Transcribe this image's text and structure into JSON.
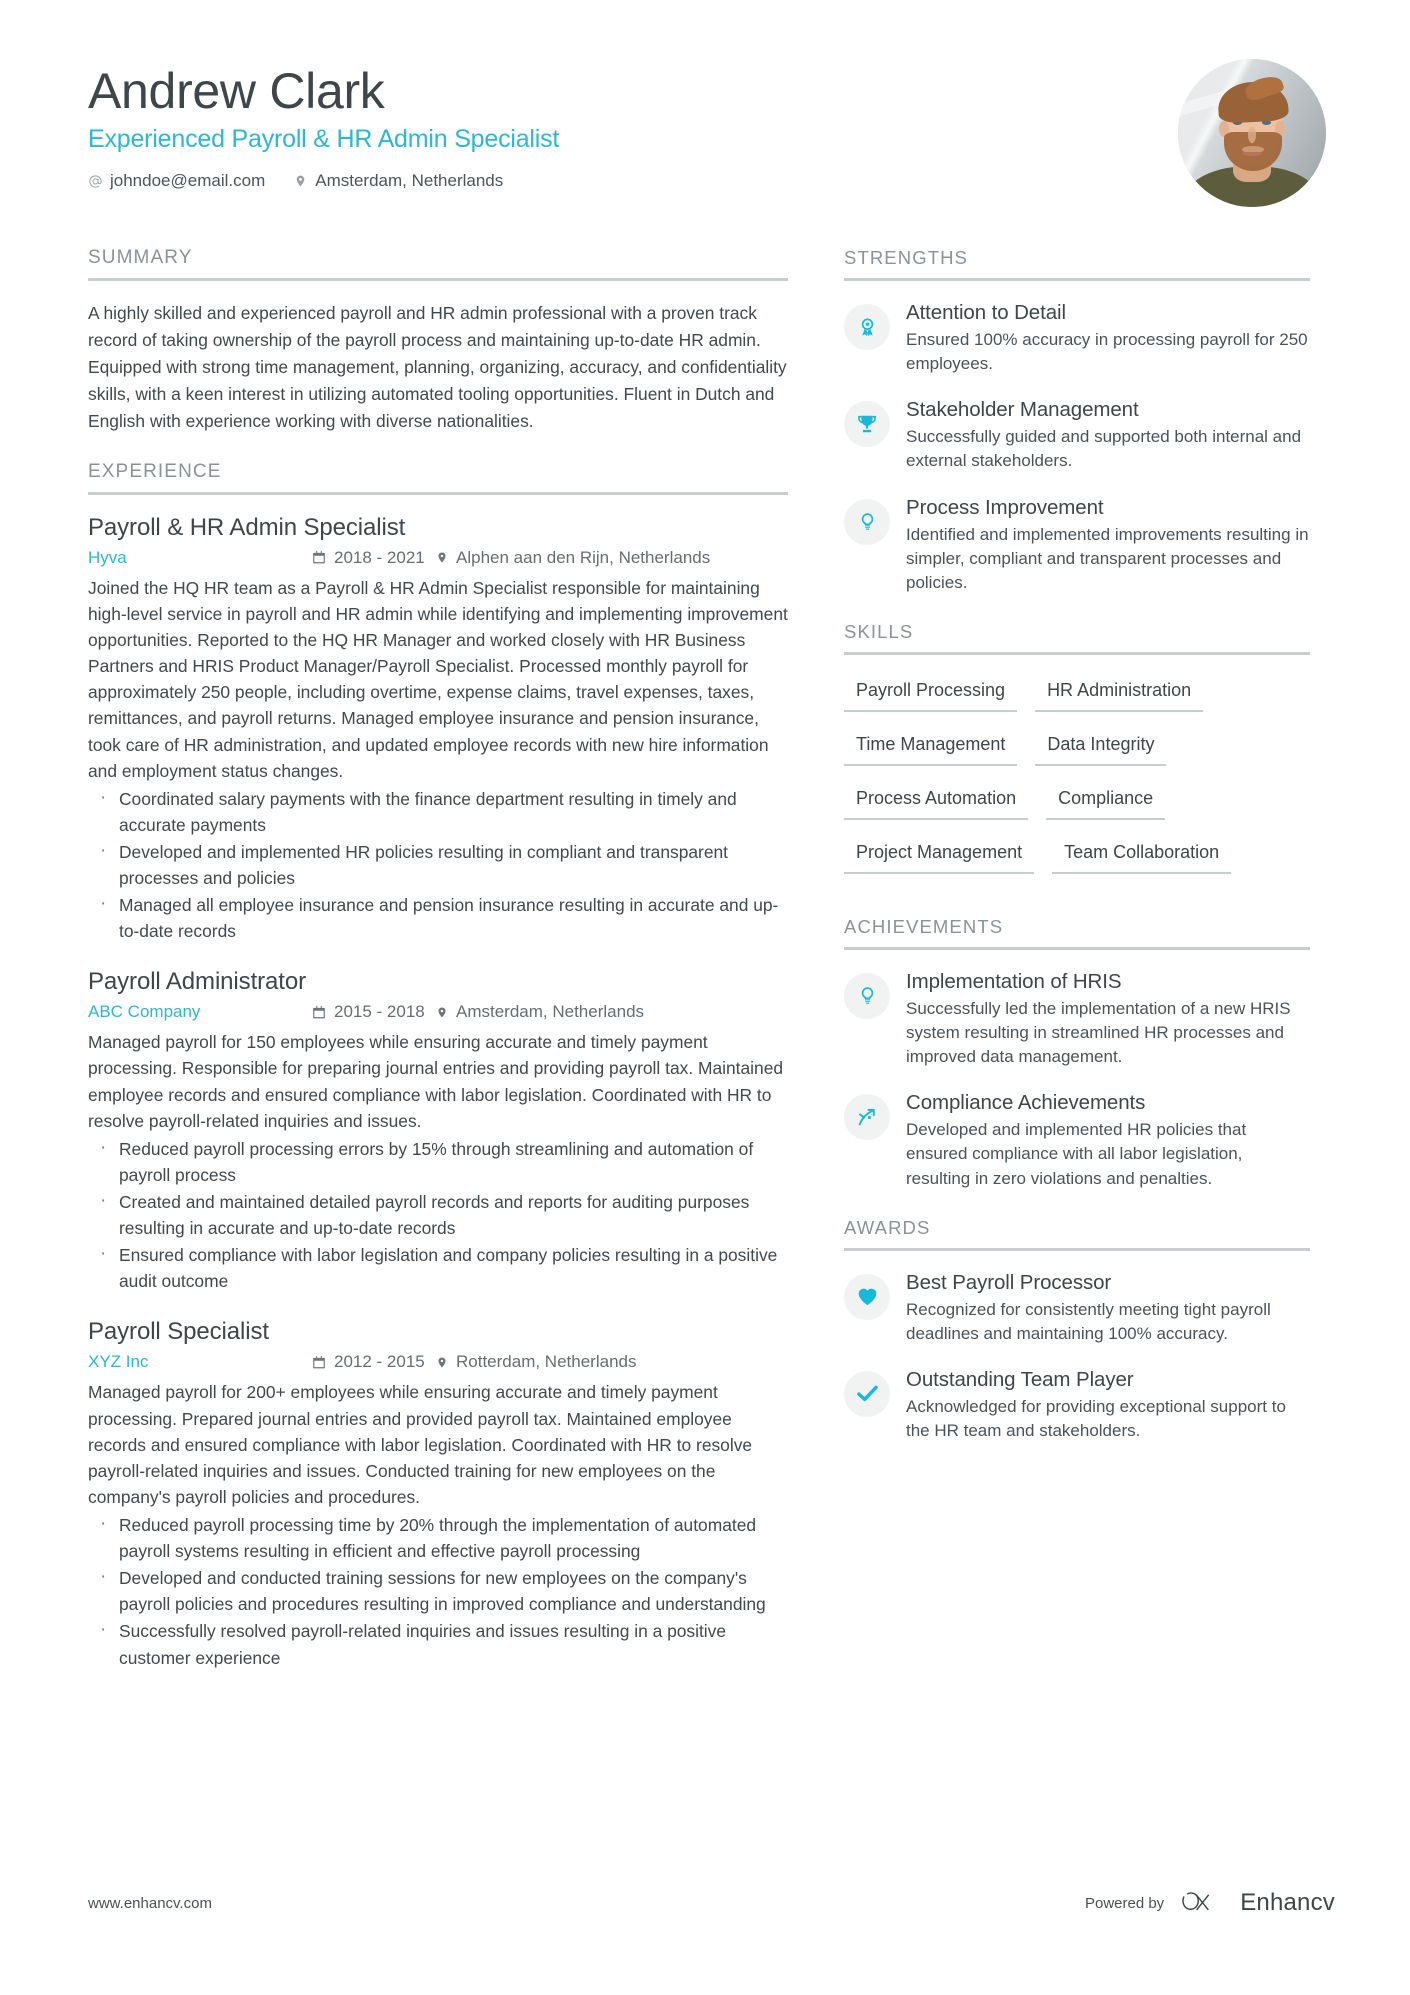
{
  "header": {
    "name": "Andrew Clark",
    "job_title": "Experienced Payroll & HR Admin Specialist",
    "contacts": [
      {
        "icon": "at-icon",
        "text": "johndoe@email.com"
      },
      {
        "icon": "location-pin-icon",
        "text": "Amsterdam, Netherlands"
      }
    ],
    "avatar_alt": "profile-photo"
  },
  "accent_color": "#2bb8d6",
  "icon_color": "#16b9d8",
  "summary": {
    "title": "SUMMARY",
    "text": "A highly skilled and experienced payroll and HR admin professional with a proven track record of taking ownership of the payroll process and maintaining up-to-date HR admin. Equipped with strong time management, planning, organizing, accuracy, and confidentiality skills, with a keen interest in utilizing automated tooling opportunities. Fluent in Dutch and English with experience working with diverse nationalities."
  },
  "experience": {
    "title": "EXPERIENCE",
    "jobs": [
      {
        "position": "Payroll & HR Admin Specialist",
        "company": "Hyva",
        "dates": "2018 - 2021",
        "location": "Alphen aan den Rijn, Netherlands",
        "description": "Joined the HQ HR team as a Payroll & HR Admin Specialist responsible for maintaining high-level service in payroll and HR admin while identifying and implementing improvement opportunities. Reported to the HQ HR Manager and worked closely with HR Business Partners and HRIS Product Manager/Payroll Specialist. Processed monthly payroll for approximately 250 people, including overtime, expense claims, travel expenses, taxes, remittances, and payroll returns. Managed employee insurance and pension insurance, took care of HR administration, and updated employee records with new hire information and employment status changes.",
        "bullets": [
          "Coordinated salary payments with the finance department resulting in timely and accurate payments",
          "Developed and implemented HR policies resulting in compliant and transparent processes and policies",
          "Managed all employee insurance and pension insurance resulting in accurate and up-to-date records"
        ]
      },
      {
        "position": "Payroll Administrator",
        "company": "ABC Company",
        "dates": "2015 - 2018",
        "location": "Amsterdam, Netherlands",
        "description": "Managed payroll for 150 employees while ensuring accurate and timely payment processing. Responsible for preparing journal entries and providing payroll tax. Maintained employee records and ensured compliance with labor legislation. Coordinated with HR to resolve payroll-related inquiries and issues.",
        "bullets": [
          "Reduced payroll processing errors by 15% through streamlining and automation of payroll process",
          "Created and maintained detailed payroll records and reports for auditing purposes resulting in accurate and up-to-date records",
          "Ensured compliance with labor legislation and company policies resulting in a positive audit outcome"
        ]
      },
      {
        "position": "Payroll Specialist",
        "company": "XYZ Inc",
        "dates": "2012 - 2015",
        "location": "Rotterdam, Netherlands",
        "description": "Managed payroll for 200+ employees while ensuring accurate and timely payment processing. Prepared journal entries and provided payroll tax. Maintained employee records and ensured compliance with labor legislation. Coordinated with HR to resolve payroll-related inquiries and issues. Conducted training for new employees on the company's payroll policies and procedures.",
        "bullets": [
          "Reduced payroll processing time by 20% through the implementation of automated payroll systems resulting in efficient and effective payroll processing",
          "Developed and conducted training sessions for new employees on the company's payroll policies and procedures resulting in improved compliance and understanding",
          "Successfully resolved payroll-related inquiries and issues resulting in a positive customer experience"
        ]
      }
    ]
  },
  "strengths": {
    "title": "STRENGTHS",
    "items": [
      {
        "icon": "award-ribbon-icon",
        "title": "Attention to Detail",
        "desc": "Ensured 100% accuracy in processing payroll for 250 employees."
      },
      {
        "icon": "trophy-icon",
        "title": "Stakeholder Management",
        "desc": "Successfully guided and supported both internal and external stakeholders."
      },
      {
        "icon": "lightbulb-icon",
        "title": "Process Improvement",
        "desc": "Identified and implemented improvements resulting in simpler, compliant and transparent processes and policies."
      }
    ]
  },
  "skills": {
    "title": "SKILLS",
    "items": [
      "Payroll Processing",
      "HR Administration",
      "Time Management",
      "Data Integrity",
      "Process Automation",
      "Compliance",
      "Project Management",
      "Team Collaboration"
    ]
  },
  "achievements": {
    "title": "ACHIEVEMENTS",
    "items": [
      {
        "icon": "lightbulb-icon",
        "title": "Implementation of HRIS",
        "desc": "Successfully led the implementation of a new HRIS system resulting in streamlined HR processes and improved data management."
      },
      {
        "icon": "growth-arrow-icon",
        "title": "Compliance Achievements",
        "desc": "Developed and implemented HR policies that ensured compliance with all labor legislation, resulting in zero violations and penalties."
      }
    ]
  },
  "awards": {
    "title": "AWARDS",
    "items": [
      {
        "icon": "heart-icon",
        "title": "Best Payroll Processor",
        "desc": "Recognized for consistently meeting tight payroll deadlines and maintaining 100% accuracy."
      },
      {
        "icon": "check-icon",
        "title": "Outstanding Team Player",
        "desc": "Acknowledged for providing exceptional support to the HR team and stakeholders."
      }
    ]
  },
  "footer": {
    "url": "www.enhancv.com",
    "powered_by": "Powered by",
    "brand": "Enhancv"
  }
}
